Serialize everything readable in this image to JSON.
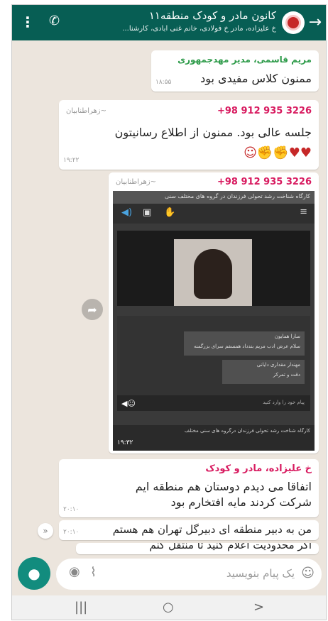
{
  "header": {
    "title": "کانون مادر و کودک منطقه۱۱",
    "subtitle": "خ علیزاده، مادر خ فولادی، خانم غنی آبادی، کارشنا..."
  },
  "messages": [
    {
      "sender": "مریم قاسمی، مدیر مهدجمهوری",
      "text": "ممنون کلاس مفیدی بود",
      "time": "۱۸:۵۵"
    },
    {
      "sender": "+98 912 935 3226",
      "alias": "~زهراطنابیان",
      "text": "جلسه عالی بود. ممنون از اطلاع رسانیتون",
      "time": "۱۹:۲۲"
    },
    {
      "sender": "+98 912 935 3226",
      "alias": "~زهراطنابیان",
      "time": "۱۹:۳۲"
    },
    {
      "sender": "خ علیزاده، مادر و کودک",
      "text": "اتفاقا می دیدم دوستان هم منطقه ایم شرکت کردند مایه افتخارم بود",
      "time": "۲۰:۱۰"
    },
    {
      "text": "من به دبیر منطقه ای دبیرگل تهران هم هستم",
      "time": "۲۰:۱۰"
    },
    {
      "text": "اگر محدودیت اعلام کنید تا منتقل کنم"
    }
  ],
  "media": {
    "top_caption": "کارگاه شناخت رشد تحولی فرزندان در گروه های مختلف سنی",
    "chat_lines": [
      {
        "name": "سارا همایون",
        "text": "سلام عرض ادب مریم بندداد همسفم سرای بزرگمنه"
      },
      {
        "name": "مهندار مقداری دایانی",
        "text": "دقت و تمرکز"
      }
    ],
    "input_placeholder": "پیام خود را وارد کنید",
    "bottom_caption": "کارگاه شناخت رشد تحولی فرزندان درگروه های سنی مختلف",
    "time": "۱۹:۳۲"
  },
  "input": {
    "placeholder": "یک پیام بنویسید"
  },
  "colors": {
    "header": "#075e54",
    "wallpaper": "#ece5dd",
    "mic": "#128c7e",
    "sender_green": "#2e9b4a",
    "sender_pink": "#d81b60"
  }
}
